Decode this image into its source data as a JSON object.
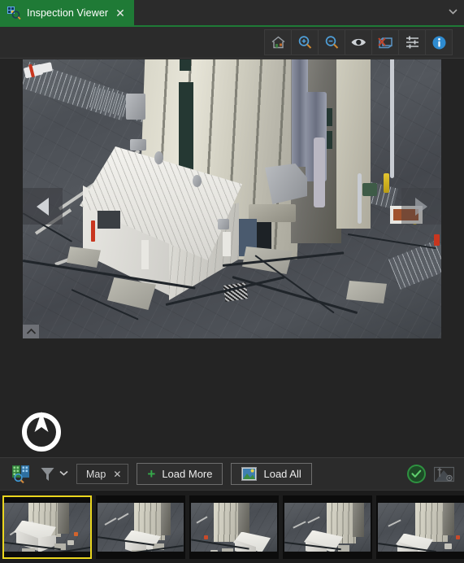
{
  "window": {
    "tab": {
      "label": "Inspection Viewer",
      "icon": "inspection-viewer-icon",
      "close_label": "✕",
      "active_color": "#1f7a36"
    },
    "overflow_chevron": "⌄"
  },
  "top_toolbar": {
    "buttons": [
      {
        "name": "home-button",
        "icon": "home-icon",
        "tooltip": "Home"
      },
      {
        "name": "zoom-in-button",
        "icon": "zoom-in-icon",
        "tooltip": "Zoom In"
      },
      {
        "name": "zoom-out-button",
        "icon": "zoom-out-icon",
        "tooltip": "Zoom Out"
      },
      {
        "name": "visibility-button",
        "icon": "eye-icon",
        "tooltip": "Show / Hide"
      },
      {
        "name": "clear-shape-button",
        "icon": "shape-delete-icon",
        "tooltip": "Clear Annotation"
      },
      {
        "name": "adjust-button",
        "icon": "sliders-icon",
        "tooltip": "Adjustments"
      },
      {
        "name": "info-button",
        "icon": "info-icon",
        "tooltip": "Information"
      }
    ]
  },
  "viewer": {
    "photo_alt": "Aerial inspection photo of industrial tower with white site container",
    "prev_arrow": "◀",
    "next_arrow": "▶",
    "compass_icon": "compass-north-icon",
    "expand_icon": "expand-corner-icon"
  },
  "bottom_toolbar": {
    "inspection_icon": "inspection-search-icon",
    "filter_icon": "filter-funnel-icon",
    "filter_chevron": "⌄",
    "chip": {
      "label": "Map",
      "remove": "✕"
    },
    "load_more": {
      "label": "Load More",
      "icon": "plus-icon"
    },
    "load_all": {
      "label": "Load All",
      "icon": "image-stack-icon"
    },
    "status": {
      "name": "status-ok",
      "icon": "check-circle-icon",
      "color": "#2e9140"
    },
    "camera_icon": "camera-measure-icon"
  },
  "thumbnails": {
    "selected_index": 0,
    "selected_border_color": "#ead61e",
    "items": [
      {
        "label": "Thumbnail 1"
      },
      {
        "label": "Thumbnail 2"
      },
      {
        "label": "Thumbnail 3"
      },
      {
        "label": "Thumbnail 4"
      },
      {
        "label": "Thumbnail 5"
      }
    ]
  }
}
